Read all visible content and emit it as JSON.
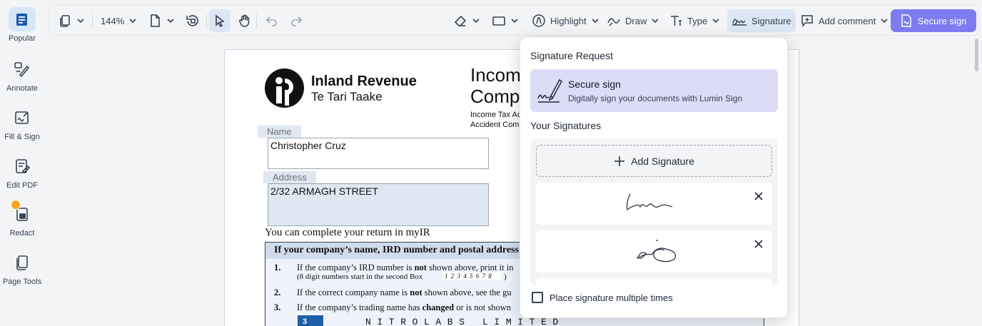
{
  "rail": {
    "items": [
      {
        "label": "Popular"
      },
      {
        "label": "Annotate"
      },
      {
        "label": "Fill & Sign"
      },
      {
        "label": "Edit PDF"
      },
      {
        "label": "Redact"
      },
      {
        "label": "Page Tools"
      }
    ]
  },
  "toolbar": {
    "zoom": "144%",
    "highlight": "Highlight",
    "draw": "Draw",
    "type": "Type",
    "signature": "Signature",
    "add_comment": "Add comment",
    "secure_sign": "Secure sign"
  },
  "document": {
    "brand_line1": "Inland Revenue",
    "brand_line2": "Te Tari Taake",
    "title": "Incom\nComp",
    "subtitle": "Income Tax Ac\nAccident Com",
    "name_label": "Name",
    "name_value": "Christopher Cruz",
    "address_label": "Address",
    "address_value": "2/32 ARMAGH STREET",
    "myir_line": "You can complete your return in myIR",
    "table_head": "If your company’s name, IRD number and postal address a",
    "rows": [
      {
        "num": "1.",
        "text": "If the company’s IRD number is not shown above, print it in",
        "sub": "(8 digit numbers start in the second Box"
      },
      {
        "num": "2.",
        "text": "If the correct company name is not shown above, see the gu"
      },
      {
        "num": "3.",
        "text": "If the company’s trading name has changed or is not shown"
      }
    ],
    "box_digits": "1 2 3 4 5 6 7 8",
    "box_close": ")",
    "row3_box": "3",
    "letters": "NITROLABS LIMITED"
  },
  "signature_panel": {
    "request_heading": "Signature Request",
    "secure_title": "Secure sign",
    "secure_desc": "Digitally sign your documents with Lumin Sign",
    "your_heading": "Your Signatures",
    "add_label": "Add Signature",
    "multi_label": "Place signature multiple times",
    "multi_checked": false
  },
  "colors": {
    "accent": "#7c7cf0",
    "active_bg": "#d6e6f7",
    "secure_card_bg": "#dcdcf7",
    "badge": "#f5a623"
  }
}
